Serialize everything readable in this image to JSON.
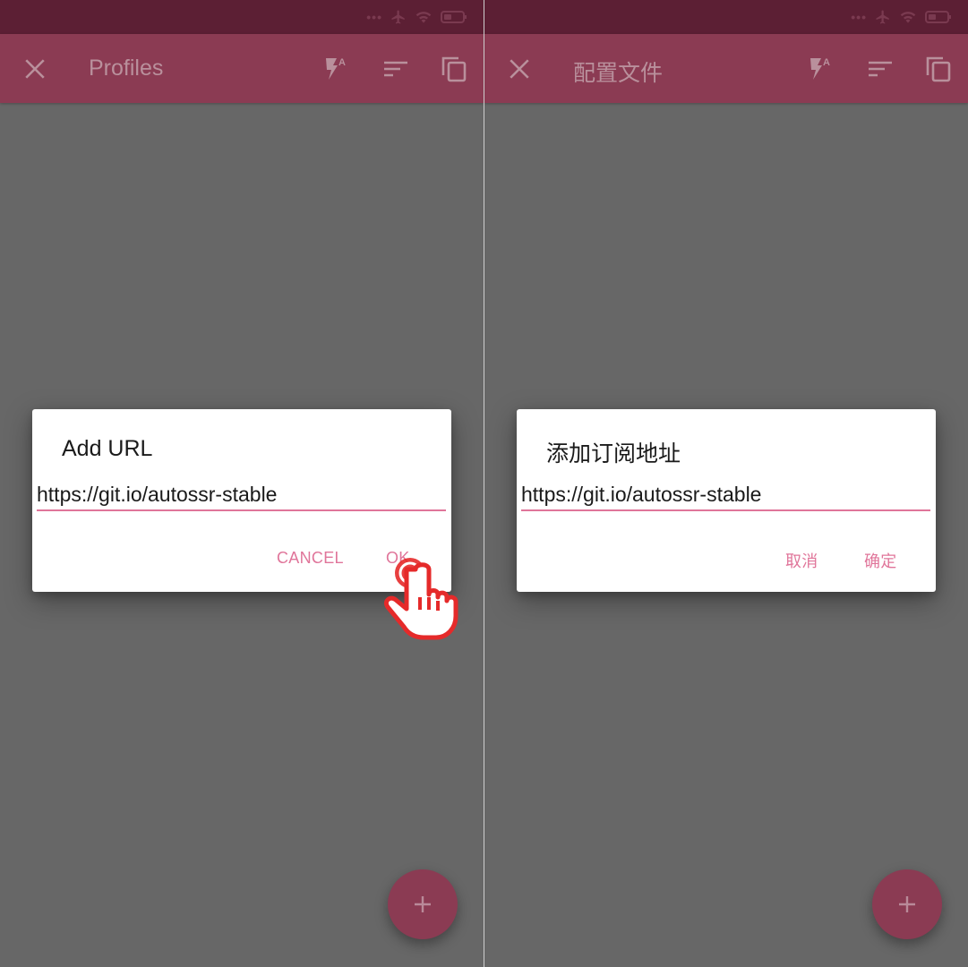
{
  "left": {
    "appbar": {
      "title": "Profiles"
    },
    "dialog": {
      "title": "Add URL",
      "url_value": "https://git.io/autossr-stable",
      "cancel_label": "CANCEL",
      "ok_label": "OK"
    },
    "fab_icon": "plus-icon"
  },
  "right": {
    "appbar": {
      "title": "配置文件"
    },
    "dialog": {
      "title": "添加订阅地址",
      "url_value": "https://git.io/autossr-stable",
      "cancel_label": "取消",
      "ok_label": "确定"
    },
    "fab_icon": "plus-icon"
  },
  "colors": {
    "primary": "#8b3b53",
    "primary_dark": "#5c1f34",
    "accent": "#e0759a",
    "scrim": "#676767"
  }
}
